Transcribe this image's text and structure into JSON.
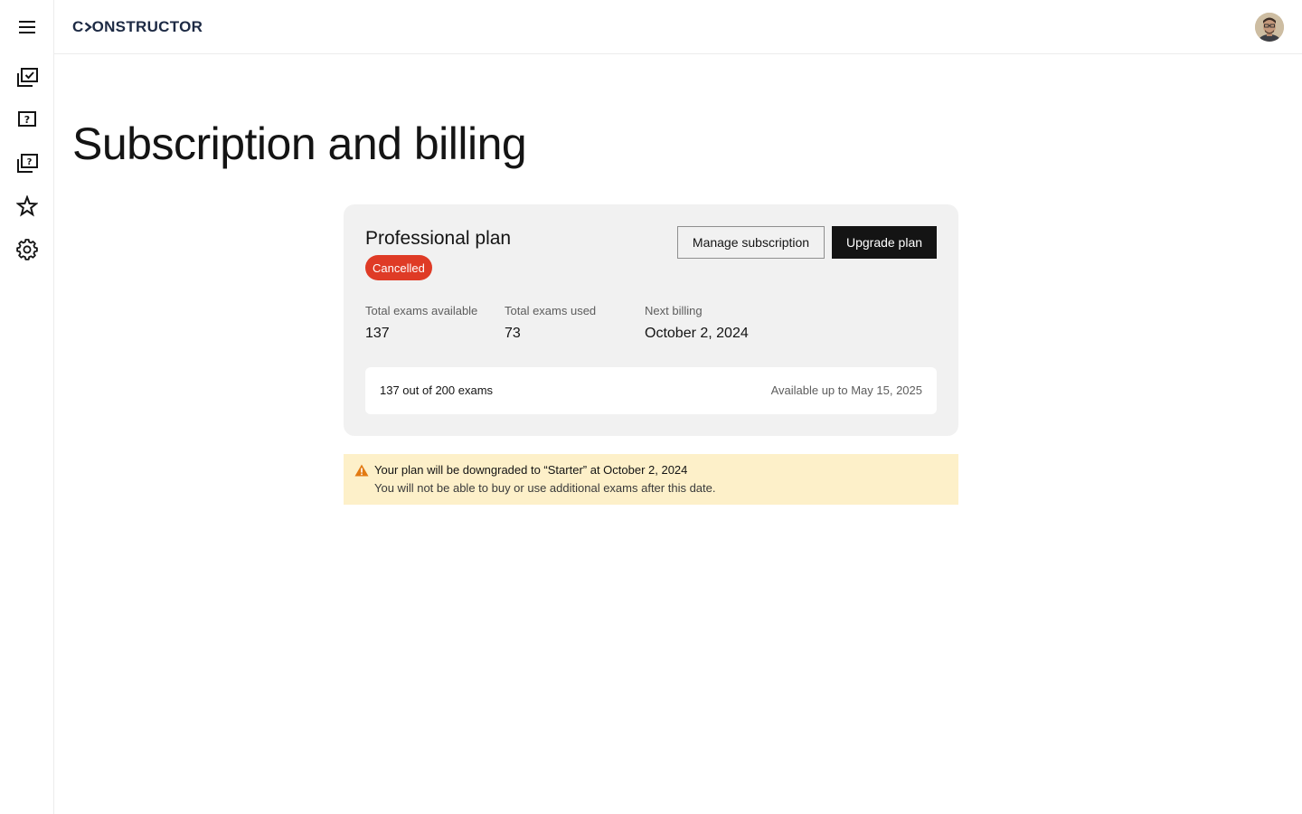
{
  "app": {
    "logo_text": "C>ONSTRUCTOR",
    "logo_prefix": "C",
    "logo_suffix": "ONSTRUCTOR"
  },
  "sidebar": {
    "menu_icon": "hamburger-menu-icon",
    "items": [
      {
        "icon": "checked-cards-icon",
        "active": false
      },
      {
        "icon": "question-card-icon",
        "active": false
      },
      {
        "icon": "question-cards-stack-icon",
        "active": false
      },
      {
        "icon": "star-icon",
        "active": false
      },
      {
        "icon": "gear-icon",
        "active": false
      }
    ]
  },
  "header": {
    "avatar": "user-avatar"
  },
  "page": {
    "title": "Subscription and billing"
  },
  "plan": {
    "name": "Professional plan",
    "status": "Cancelled",
    "status_color": "#df3b26",
    "manage_label": "Manage subscription",
    "upgrade_label": "Upgrade plan",
    "stats": [
      {
        "label": "Total exams available",
        "value": "137"
      },
      {
        "label": "Total exams used",
        "value": "73"
      },
      {
        "label": "Next billing",
        "value": "October 2, 2024"
      }
    ],
    "usage_text": "137 out of 200 exams",
    "available_until": "Available up to May 15, 2025"
  },
  "warning": {
    "icon": "warning-triangle-icon",
    "title": "Your plan will be downgraded to “Starter” at October 2, 2024",
    "message": "You will not be able to buy or use additional exams after this date.",
    "background": "#fdf0c9",
    "icon_color": "#e27a12"
  }
}
